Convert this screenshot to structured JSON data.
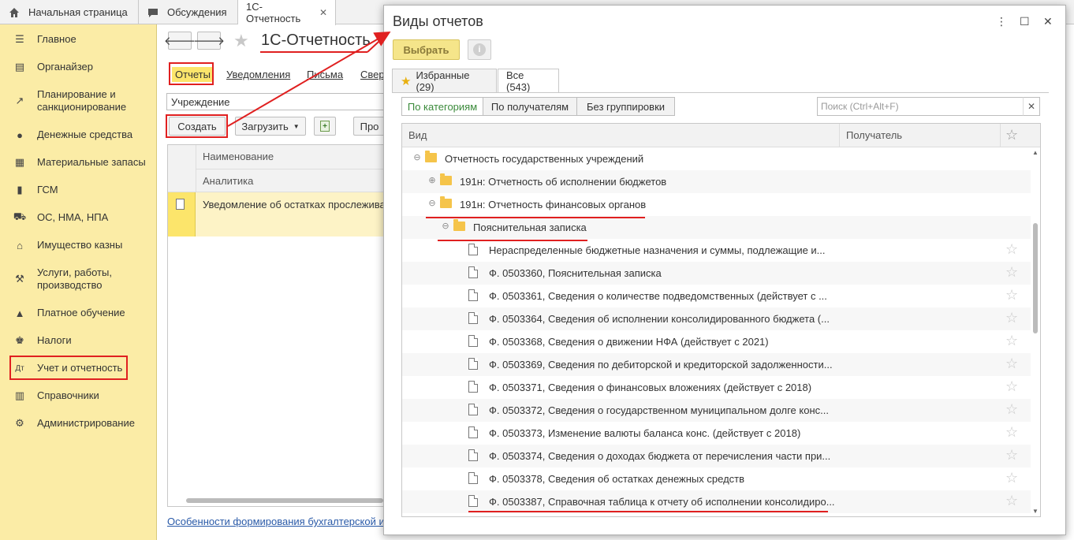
{
  "tabs": {
    "home": "Начальная страница",
    "discussions": "Обсуждения",
    "current": "1С-Отчетность"
  },
  "sidebar": {
    "items": [
      {
        "label": "Главное",
        "icon": "menu-icon"
      },
      {
        "label": "Органайзер",
        "icon": "organizer-icon"
      },
      {
        "label": "Планирование и\nсанкционирование",
        "icon": "planning-icon"
      },
      {
        "label": "Денежные средства",
        "icon": "money-icon"
      },
      {
        "label": "Материальные запасы",
        "icon": "materials-icon"
      },
      {
        "label": "ГСМ",
        "icon": "fuel-icon"
      },
      {
        "label": "ОС, НМА, НПА",
        "icon": "truck-icon"
      },
      {
        "label": "Имущество казны",
        "icon": "treasury-icon"
      },
      {
        "label": "Услуги, работы,\nпроизводство",
        "icon": "tools-icon"
      },
      {
        "label": "Платное обучение",
        "icon": "education-icon"
      },
      {
        "label": "Налоги",
        "icon": "taxes-icon"
      },
      {
        "label": "Учет и отчетность",
        "icon": "accounting-icon"
      },
      {
        "label": "Справочники",
        "icon": "books-icon"
      },
      {
        "label": "Администрирование",
        "icon": "gear-icon"
      }
    ]
  },
  "main": {
    "title": "1С-Отчетность",
    "tabs": [
      "Отчеты",
      "Уведомления",
      "Письма",
      "Свер"
    ],
    "org_field": "Учреждение",
    "create_btn": "Создать",
    "load_btn": "Загрузить",
    "pro_btn": "Про",
    "col_name": "Наименование",
    "col_analytics": "Аналитика",
    "row_text": "Уведомление об остатках прослежива",
    "bottom_link": "Особенности формирования бухгалтерской и"
  },
  "modal": {
    "title": "Виды отчетов",
    "select_btn": "Выбрать",
    "filter_tabs": [
      "Избранные (29)",
      "Все (543)"
    ],
    "group_buttons": [
      "По категориям",
      "По получателям",
      "Без группировки"
    ],
    "search_placeholder": "Поиск (Ctrl+Alt+F)",
    "col_kind": "Вид",
    "col_recipient": "Получатель",
    "rows": [
      {
        "text": "Отчетность государственных учреждений",
        "level": 0,
        "type": "folder",
        "toggle": "⊖"
      },
      {
        "text": "191н: Отчетность об исполнении бюджетов",
        "level": 1,
        "type": "folder",
        "toggle": "⊕"
      },
      {
        "text": "191н: Отчетность финансовых органов",
        "level": 1,
        "type": "folder",
        "toggle": "⊖"
      },
      {
        "text": "Пояснительная записка",
        "level": 2,
        "type": "folder",
        "toggle": "⊖"
      },
      {
        "text": "Нераспределенные бюджетные назначения и суммы, подлежащие и...",
        "level": 3,
        "type": "doc"
      },
      {
        "text": "Ф. 0503360, Пояснительная записка",
        "level": 3,
        "type": "doc"
      },
      {
        "text": "Ф. 0503361, Сведения о количестве подведомственных (действует с ...",
        "level": 3,
        "type": "doc"
      },
      {
        "text": "Ф. 0503364, Сведения об исполнении консолидированного бюджета (...",
        "level": 3,
        "type": "doc"
      },
      {
        "text": "Ф. 0503368, Сведения о движении НФА (действует с 2021)",
        "level": 3,
        "type": "doc"
      },
      {
        "text": "Ф. 0503369, Сведения по дебиторской и кредиторской задолженности...",
        "level": 3,
        "type": "doc"
      },
      {
        "text": "Ф. 0503371, Сведения о финансовых вложениях (действует с 2018)",
        "level": 3,
        "type": "doc"
      },
      {
        "text": "Ф. 0503372, Сведения о государственном муниципальном долге конс...",
        "level": 3,
        "type": "doc"
      },
      {
        "text": "Ф. 0503373, Изменение валюты баланса конс. (действует с 2018)",
        "level": 3,
        "type": "doc"
      },
      {
        "text": "Ф. 0503374, Сведения о доходах бюджета от перечисления части при...",
        "level": 3,
        "type": "doc"
      },
      {
        "text": "Ф. 0503378, Сведения об остатках денежных средств",
        "level": 3,
        "type": "doc"
      },
      {
        "text": "Ф. 0503387, Справочная таблица к отчету об исполнении консолидиро...",
        "level": 3,
        "type": "doc"
      }
    ]
  }
}
